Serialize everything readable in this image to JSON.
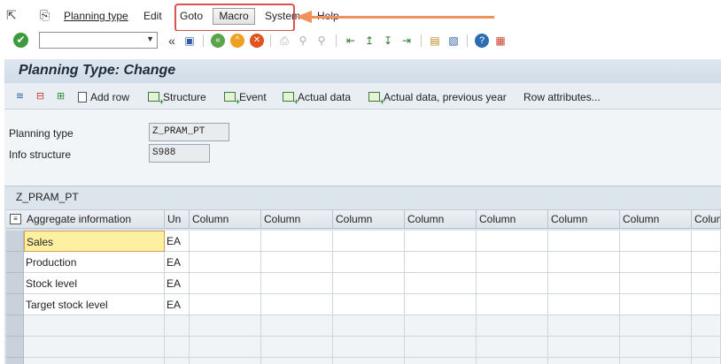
{
  "menu": {
    "items": [
      "Planning type",
      "Edit",
      "Goto",
      "Macro",
      "System",
      "Help"
    ],
    "underline_first": true
  },
  "toolbar": {
    "command_field_value": ""
  },
  "page": {
    "title": "Planning Type: Change"
  },
  "app_toolbar": {
    "buttons": [
      "Add row",
      "Structure",
      "Event",
      "Actual data",
      "Actual data, previous year",
      "Row attributes..."
    ]
  },
  "fields": {
    "planning_type_label": "Planning type",
    "planning_type_value": "Z_PRAM_PT",
    "info_structure_label": "Info structure",
    "info_structure_value": "S988"
  },
  "table": {
    "title": "Z_PRAM_PT",
    "headers": [
      "Aggregate information",
      "Un",
      "Column",
      "Column",
      "Column",
      "Column",
      "Column",
      "Column",
      "Column",
      "Colum"
    ],
    "rows": [
      {
        "label": "Sales",
        "unit": "EA"
      },
      {
        "label": "Production",
        "unit": "EA"
      },
      {
        "label": "Stock level",
        "unit": "EA"
      },
      {
        "label": "Target stock level",
        "unit": "EA"
      }
    ]
  },
  "colors": {
    "annotation_box": "#d9534f",
    "annotation_arrow": "#f0905a",
    "title_bar": "#dfe8f1",
    "active_cell": "#fdf0a0"
  }
}
